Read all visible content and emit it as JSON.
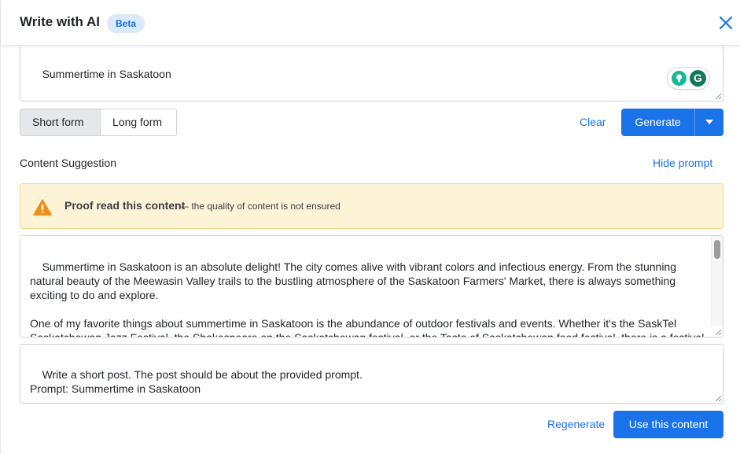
{
  "header": {
    "title": "Write with AI",
    "badge": "Beta",
    "close_icon": "close-icon"
  },
  "prompt_input": {
    "value": "Summertime in Saskatoon"
  },
  "grammarly": {
    "bulb_icon": "lightbulb-icon",
    "logo": "G"
  },
  "form_toggle": {
    "options": [
      "Short form",
      "Long form"
    ],
    "selected": "Short form"
  },
  "actions": {
    "clear_label": "Clear",
    "generate_label": "Generate",
    "dropdown_icon": "chevron-down-icon"
  },
  "content": {
    "section_label": "Content Suggestion",
    "hide_prompt_label": "Hide prompt",
    "warning": {
      "icon": "warning-icon",
      "strong": "Proof read this content",
      "rest": "— the quality of content is not ensured"
    },
    "text": "Summertime in Saskatoon is an absolute delight! The city comes alive with vibrant colors and infectious energy. From the stunning natural beauty of the Meewasin Valley trails to the bustling atmosphere of the Saskatoon Farmers' Market, there is always something exciting to do and explore.\n\nOne of my favorite things about summertime in Saskatoon is the abundance of outdoor festivals and events. Whether it's the SaskTel Saskatchewan Jazz Festival, the Shakespeare on the Saskatchewan festival, or the Taste of Saskatchewan food festival, there is a festival for every interest and palate. These events truly showcase the city's cultural diversity and artistic talent.",
    "instructions": "Write a short post. The post should be about the provided prompt.\nPrompt: Summertime in Saskatoon"
  },
  "footer": {
    "regenerate_label": "Regenerate",
    "use_label": "Use this content"
  },
  "colors": {
    "accent": "#1a73e8",
    "warning_bg": "#fdf4d8",
    "warning_icon": "#f28c14",
    "badge_bg": "#dbeafa"
  }
}
